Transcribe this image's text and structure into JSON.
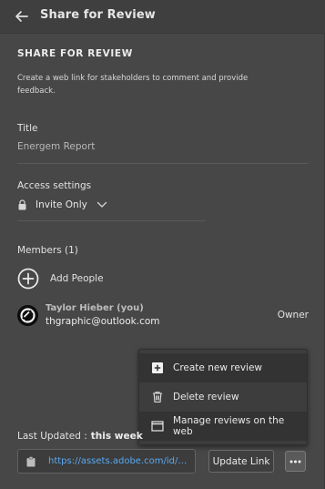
{
  "header": {
    "title": "Share for Review",
    "back_icon": "arrow-left-icon"
  },
  "intro": {
    "heading": "SHARE FOR REVIEW",
    "description": "Create a web link for stakeholders to comment and provide feedback."
  },
  "title_field": {
    "label": "Title",
    "value": "Energem Report"
  },
  "access": {
    "label": "Access settings",
    "value": "Invite Only",
    "icon": "lock-icon"
  },
  "members": {
    "label": "Members (1)",
    "add_label": "Add People",
    "list": [
      {
        "name": "Taylor Hieber (you)",
        "email": "thgraphic@outlook.com",
        "role": "Owner"
      }
    ]
  },
  "menu": {
    "items": [
      {
        "label": "Create new review",
        "icon": "plus-square-icon"
      },
      {
        "label": "Delete review",
        "icon": "trash-icon"
      },
      {
        "label": "Manage reviews on the web",
        "icon": "window-icon"
      }
    ]
  },
  "footer": {
    "last_updated_label": "Last Updated :",
    "last_updated_value": "this week",
    "link_url": "https://assets.adobe.com/id/ur...",
    "update_button": "Update Link",
    "more_icon": "ellipsis-icon"
  },
  "colors": {
    "background": "#474747",
    "link": "#5aa9f0",
    "menu_bg": "#3d3d3d",
    "menu_highlight": "#333333"
  }
}
